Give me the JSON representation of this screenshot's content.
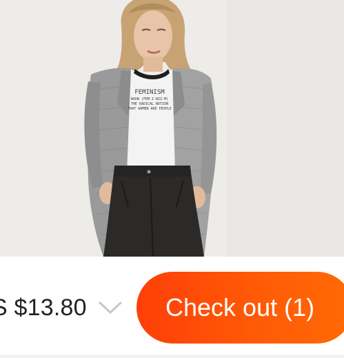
{
  "product": {
    "image_alt_icon": "model-wearing-blazer-image",
    "tee_print": {
      "headline": "FEMINISM",
      "line1": "NOUN (FEM-I-NIZ-M)",
      "line2": "THE RADICAL NOTION",
      "line3": "THAT WOMEN ARE PEOPLE"
    }
  },
  "checkout": {
    "total_price": "S $13.80",
    "expand_icon": "chevron-down-icon",
    "button_label": "Check out (1)"
  },
  "colors": {
    "accent": "#ff4a07",
    "price_text": "#222222",
    "chevron": "#c7c7c7"
  }
}
